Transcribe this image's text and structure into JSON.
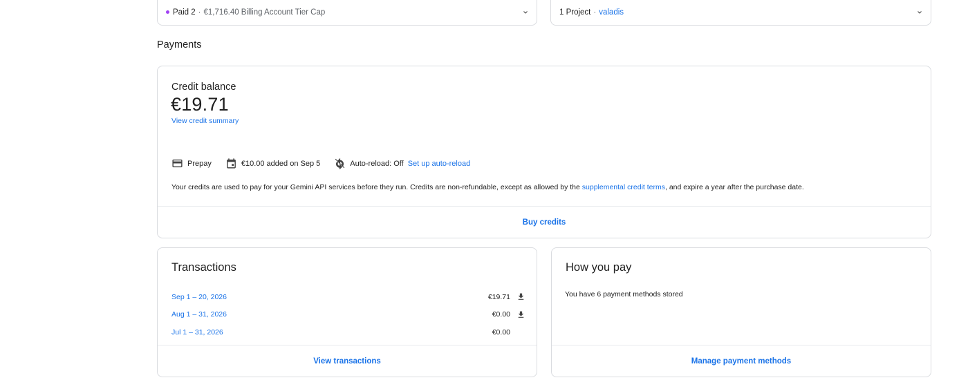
{
  "top_cards": {
    "tier": {
      "label": "Paid 2",
      "separator": "·",
      "detail": "€1,716.40 Billing Account Tier Cap",
      "dot_color": "#a142f4"
    },
    "project": {
      "label": "1 Project",
      "separator": "·",
      "link": "valadis"
    }
  },
  "payments": {
    "section_title": "Payments",
    "credit": {
      "label": "Credit balance",
      "amount": "€19.71",
      "summary_link": "View credit summary",
      "prepay_label": "Prepay",
      "added_label": "€10.00 added on Sep 5",
      "autoreload_label": "Auto-reload: Off",
      "autoreload_link": "Set up auto-reload",
      "notice_before": "Your credits are used to pay for your Gemini API services before they run. Credits are non-refundable, except as allowed by the ",
      "notice_link": "supplemental credit terms",
      "notice_after": ", and expire a year after the purchase date.",
      "buy_button": "Buy credits"
    },
    "transactions": {
      "title": "Transactions",
      "rows": [
        {
          "date": "Sep 1 – 20, 2026",
          "amount": "€19.71",
          "download": true
        },
        {
          "date": "Aug 1 – 31, 2026",
          "amount": "€0.00",
          "download": true
        },
        {
          "date": "Jul 1 – 31, 2026",
          "amount": "€0.00",
          "download": false
        }
      ],
      "view_button": "View transactions"
    },
    "how_you_pay": {
      "title": "How you pay",
      "text": "You have 6 payment methods stored",
      "manage_button": "Manage payment methods"
    }
  },
  "colors": {
    "accent": "#1a73e8",
    "border": "#dadce0"
  },
  "icons": [
    "chevron-down-icon",
    "credit-card-icon",
    "calendar-icon",
    "autoreload-off-icon",
    "download-icon"
  ]
}
